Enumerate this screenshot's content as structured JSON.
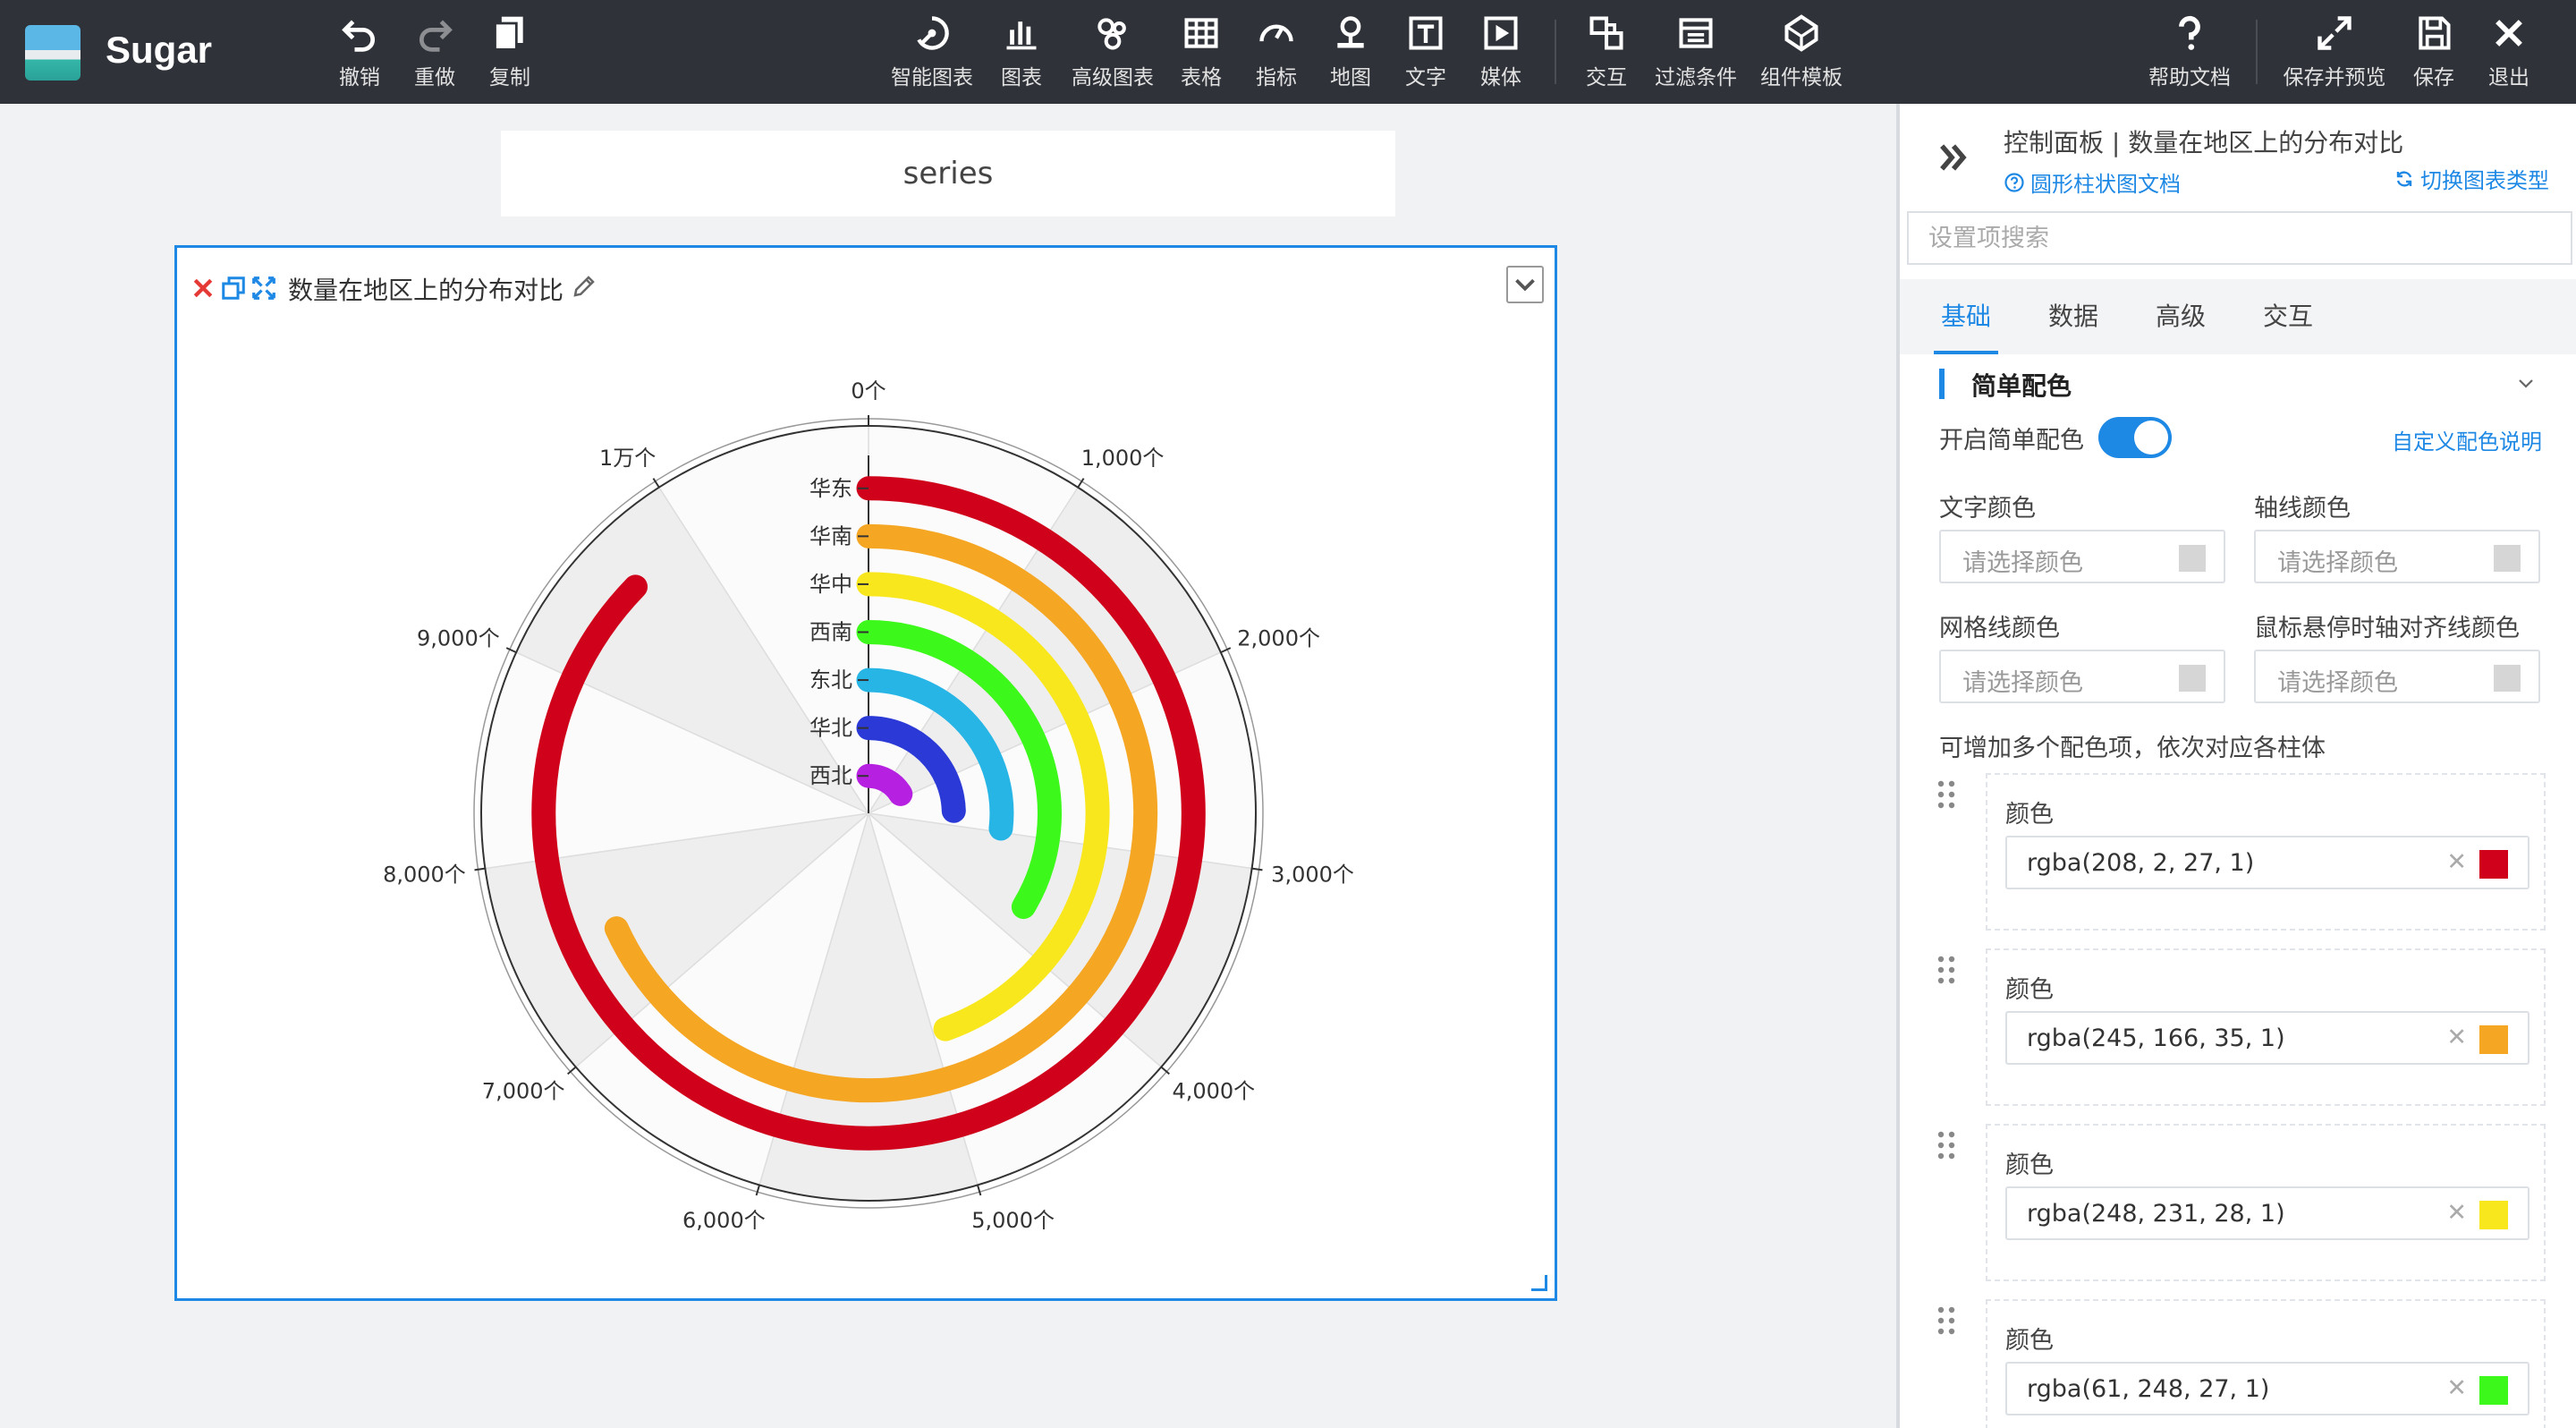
{
  "app": {
    "name": "Sugar"
  },
  "toolbar": {
    "left": [
      {
        "label": "撤销",
        "icon": "undo-icon"
      },
      {
        "label": "重做",
        "icon": "redo-icon"
      },
      {
        "label": "复制",
        "icon": "copy-icon"
      }
    ],
    "center": [
      {
        "label": "智能图表",
        "icon": "smart-chart-icon"
      },
      {
        "label": "图表",
        "icon": "bar-chart-icon"
      },
      {
        "label": "高级图表",
        "icon": "advanced-chart-icon"
      },
      {
        "label": "表格",
        "icon": "table-icon"
      },
      {
        "label": "指标",
        "icon": "gauge-icon"
      },
      {
        "label": "地图",
        "icon": "map-pin-icon"
      },
      {
        "label": "文字",
        "icon": "text-icon"
      },
      {
        "label": "媒体",
        "icon": "media-icon"
      },
      {
        "label": "交互",
        "icon": "interaction-icon"
      },
      {
        "label": "过滤条件",
        "icon": "filter-icon"
      },
      {
        "label": "组件模板",
        "icon": "template-icon"
      }
    ],
    "right": [
      {
        "label": "帮助文档",
        "icon": "help-icon"
      },
      {
        "label": "保存并预览",
        "icon": "expand-icon"
      },
      {
        "label": "保存",
        "icon": "save-icon"
      },
      {
        "label": "退出",
        "icon": "close-icon"
      }
    ]
  },
  "canvas": {
    "series_label": "series",
    "widget_title": "数量在地区上的分布对比"
  },
  "chart_data": {
    "type": "polar-bar",
    "angle_axis": {
      "min": 0,
      "max": 11000,
      "tick_labels": [
        "0个",
        "1,000个",
        "2,000个",
        "3,000个",
        "4,000个",
        "5,000个",
        "6,000个",
        "7,000个",
        "8,000个",
        "9,000个",
        "1万个"
      ]
    },
    "categories": [
      "华东",
      "华南",
      "华中",
      "西南",
      "东北",
      "华北",
      "西北"
    ],
    "values": [
      9600,
      7500,
      4900,
      3700,
      2950,
      2700,
      1800
    ],
    "colors": [
      "#d0021b",
      "#f5a623",
      "#f8e71c",
      "#3df81b",
      "#27b5e6",
      "#2b3ad6",
      "#b620e0"
    ]
  },
  "panel": {
    "header_title": "控制面板 | 数量在地区上的分布对比",
    "doc_link": "圆形柱状图文档",
    "switch_type": "切换图表类型",
    "search_placeholder": "设置项搜索",
    "tabs": [
      "基础",
      "数据",
      "高级",
      "交互"
    ],
    "section_title": "简单配色",
    "enable_label": "开启简单配色",
    "custom_link": "自定义配色说明",
    "text_color_label": "文字颜色",
    "axis_color_label": "轴线颜色",
    "grid_color_label": "网格线颜色",
    "hover_color_label": "鼠标悬停时轴对齐线颜色",
    "color_placeholder": "请选择颜色",
    "multi_hint": "可增加多个配色项，依次对应各柱体",
    "color_items": [
      {
        "label": "颜色",
        "value": "rgba(208, 2, 27, 1)",
        "swatch": "#d0021b"
      },
      {
        "label": "颜色",
        "value": "rgba(245, 166, 35, 1)",
        "swatch": "#f5a623"
      },
      {
        "label": "颜色",
        "value": "rgba(248, 231, 28, 1)",
        "swatch": "#f8e71c"
      },
      {
        "label": "颜色",
        "value": "rgba(61, 248, 27, 1)",
        "swatch": "#3df81b"
      }
    ]
  }
}
